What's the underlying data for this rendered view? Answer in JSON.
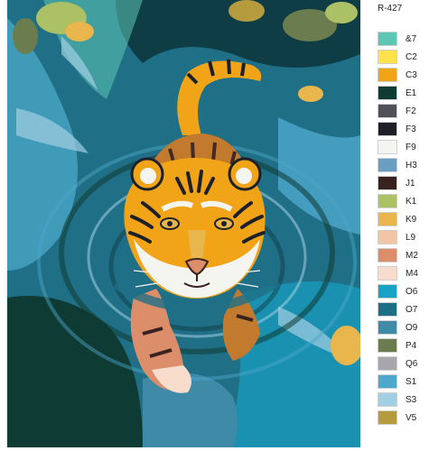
{
  "painting_code": "R-427",
  "palette": [
    {
      "code": "&7",
      "color": "#5ec6b5"
    },
    {
      "code": "C2",
      "color": "#ffe24a"
    },
    {
      "code": "C3",
      "color": "#f2a419"
    },
    {
      "code": "E1",
      "color": "#0e3b33"
    },
    {
      "code": "F2",
      "color": "#4e5258"
    },
    {
      "code": "F3",
      "color": "#1d2127"
    },
    {
      "code": "F9",
      "color": "#f4f4f1"
    },
    {
      "code": "H3",
      "color": "#6a9ec3"
    },
    {
      "code": "J1",
      "color": "#382220"
    },
    {
      "code": "K1",
      "color": "#acc065"
    },
    {
      "code": "K9",
      "color": "#e8b64c"
    },
    {
      "code": "L9",
      "color": "#f2c5a6"
    },
    {
      "code": "M2",
      "color": "#dc8d6a"
    },
    {
      "code": "M4",
      "color": "#f8ddcd"
    },
    {
      "code": "O6",
      "color": "#18a3c6"
    },
    {
      "code": "O7",
      "color": "#1c6f87"
    },
    {
      "code": "O9",
      "color": "#3f8aa7"
    },
    {
      "code": "P4",
      "color": "#6b7d4e"
    },
    {
      "code": "Q6",
      "color": "#a9a6ad"
    },
    {
      "code": "S1",
      "color": "#4da8cc"
    },
    {
      "code": "S3",
      "color": "#a2cfe3"
    },
    {
      "code": "V5",
      "color": "#b59b3d"
    }
  ]
}
